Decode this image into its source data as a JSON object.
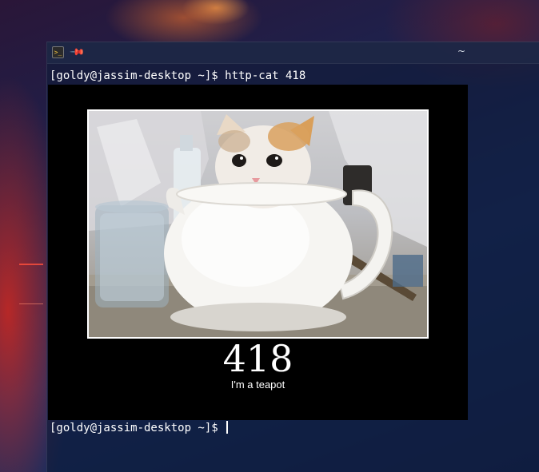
{
  "window": {
    "title": "~",
    "app_icon": "terminal-icon",
    "pin_icon": "pin-icon"
  },
  "terminal": {
    "command_prompt": "[goldy@jassim-desktop ~]$ http-cat 418",
    "idle_prompt": "[goldy@jassim-desktop ~]$ "
  },
  "output_image": {
    "status_code": "418",
    "status_text": "I'm a teapot",
    "depicts": "kitten-in-teapot-photo"
  },
  "colors": {
    "terminal_text": "#ffffff",
    "image_background": "#000000",
    "frame_border": "#ffffff"
  }
}
